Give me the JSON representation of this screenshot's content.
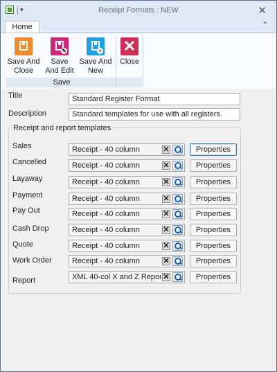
{
  "window": {
    "title": "Receipt Formats : NEW",
    "close_glyph": "✕",
    "qa_arrow": "▾"
  },
  "ribbon": {
    "tab_home": "Home",
    "collapse_glyph": "⌃",
    "save_group_label": "Save",
    "save_and_close": [
      "Save And",
      "Close"
    ],
    "save_and_edit": [
      "Save",
      "And Edit"
    ],
    "save_and_new": [
      "Save And",
      "New"
    ],
    "close": "Close",
    "colors": {
      "save_close": "#f08a2b",
      "save_edit": "#d1277b",
      "save_new": "#1da1e3",
      "close": "#cf2e59"
    },
    "icons": {
      "save_close": "floppy-disk-icon",
      "save_edit": "floppy-disk-edit-icon",
      "save_new": "floppy-disk-new-icon",
      "close": "close-x-icon"
    }
  },
  "form": {
    "title_label": "Title",
    "title_value": "Standard Register Format",
    "description_label": "Description",
    "description_value": "Standard templates for use with all registers.",
    "group_title": "Receipt and report templates",
    "properties_label": "Properties",
    "templates": [
      {
        "label": "Sales",
        "value": "Receipt - 40 column"
      },
      {
        "label": "Cancelled",
        "value": "Receipt - 40 column"
      },
      {
        "label": "Layaway",
        "value": "Receipt - 40 column"
      },
      {
        "label": "Payment",
        "value": "Receipt - 40 column"
      },
      {
        "label": "Pay Out",
        "value": "Receipt - 40 column"
      },
      {
        "label": "Cash Drop",
        "value": "Receipt - 40 column"
      },
      {
        "label": "Quote",
        "value": "Receipt - 40 column"
      },
      {
        "label": "Work Order",
        "value": "Receipt - 40 column"
      },
      {
        "label": "Report",
        "value": "XML 40-col X and Z Report and"
      }
    ]
  }
}
